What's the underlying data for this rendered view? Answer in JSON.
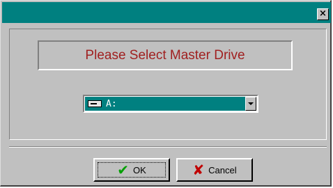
{
  "dialog": {
    "close_symbol": "×",
    "heading": "Please Select Master Drive",
    "drive_select": {
      "selected": "A:",
      "icon": "floppy-drive-icon"
    },
    "buttons": {
      "ok_label": "OK",
      "ok_icon": "checkmark-icon",
      "ok_glyph": "✔",
      "cancel_label": "Cancel",
      "cancel_icon": "x-mark-icon",
      "cancel_glyph": "✘"
    },
    "colors": {
      "titlebar": "#008080",
      "heading_text": "#a02020",
      "selection": "#008080"
    }
  }
}
